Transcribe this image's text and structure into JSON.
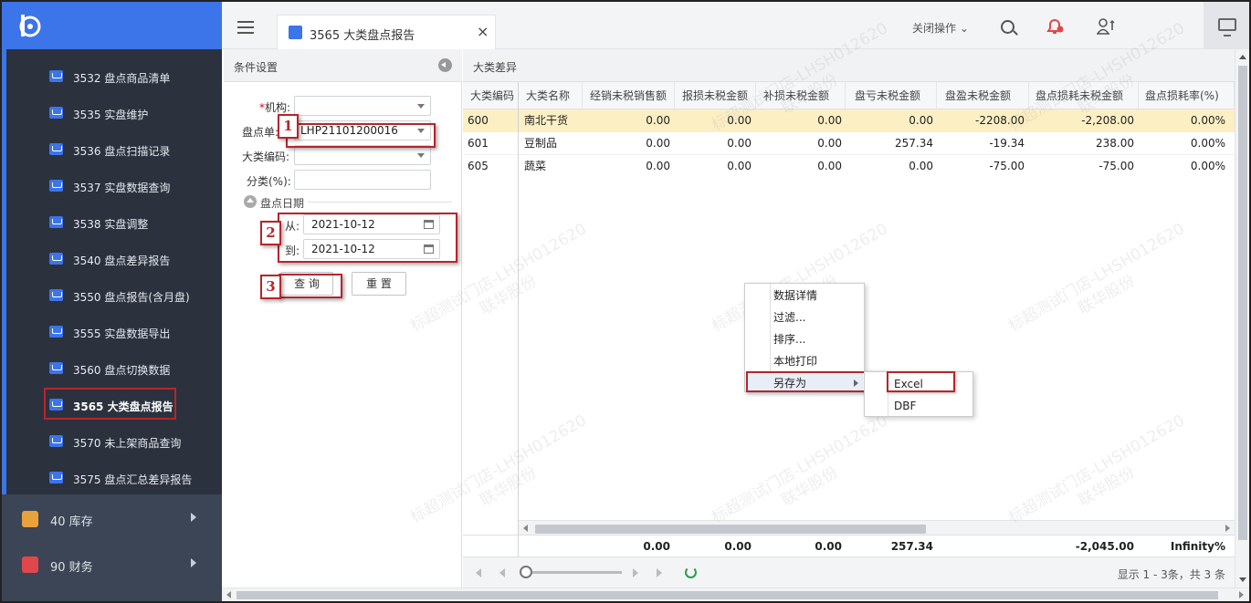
{
  "sidebar": {
    "items": [
      {
        "label": "3532 盘点商品清单"
      },
      {
        "label": "3535 实盘维护"
      },
      {
        "label": "3536 盘点扫描记录"
      },
      {
        "label": "3537 实盘数据查询"
      },
      {
        "label": "3538 实盘调整"
      },
      {
        "label": "3540 盘点差异报告"
      },
      {
        "label": "3550 盘点报告(含月盘)"
      },
      {
        "label": "3555 实盘数据导出"
      },
      {
        "label": "3560 盘点切换数据"
      },
      {
        "label": "3565 大类盘点报告"
      },
      {
        "label": "3570 未上架商品查询"
      },
      {
        "label": "3575 盘点汇总差异报告"
      }
    ],
    "groups": [
      {
        "label": "40 库存",
        "icon": "warehouse-icon",
        "color": "#e9a23b"
      },
      {
        "label": "90 财务",
        "icon": "finance-icon",
        "color": "#e0474c"
      }
    ]
  },
  "topbar": {
    "tab_title": "3565 大类盘点报告",
    "tab_close": "×",
    "close_ops": "关闭操作 ⌄"
  },
  "filter": {
    "title": "条件设置",
    "org_label": "机构:",
    "org_required": "*",
    "org_value": "",
    "sheet_label": "盘点单:",
    "sheet_value": "LHP21101200016",
    "category_label": "大类编码:",
    "category_value": "",
    "class_label": "分类(%):",
    "class_value": "",
    "date_section": "盘点日期",
    "from_label": "从:",
    "from_value": "2021-10-12",
    "to_label": "到:",
    "to_value": "2021-10-12",
    "query_btn": "查 询",
    "reset_btn": "重 置"
  },
  "callouts": [
    "1",
    "2",
    "3"
  ],
  "report": {
    "title": "大类差异",
    "columns": [
      "大类编码",
      "大类名称",
      "经销未税销售额",
      "报损未税金额",
      "补损未税金额",
      "盘亏未税金额",
      "盘盈未税金额",
      "盘点损耗未税金额",
      "盘点损耗率(%)"
    ],
    "rows": [
      [
        "600",
        "南北干货",
        "0.00",
        "0.00",
        "0.00",
        "0.00",
        "-2208.00",
        "-2,208.00",
        "0.00%"
      ],
      [
        "601",
        "豆制品",
        "0.00",
        "0.00",
        "0.00",
        "257.34",
        "-19.34",
        "238.00",
        "0.00%"
      ],
      [
        "605",
        "蔬菜",
        "0.00",
        "0.00",
        "0.00",
        "0.00",
        "-75.00",
        "-75.00",
        "0.00%"
      ]
    ],
    "totals": [
      "0.00",
      "0.00",
      "0.00",
      "257.34",
      "",
      "-2,045.00",
      "Infinity%"
    ],
    "pager_info": "显示 1 - 3条，共 3 条"
  },
  "context_menu": {
    "items": [
      "数据详情",
      "过滤...",
      "排序...",
      "本地打印",
      "另存为"
    ],
    "submenu": [
      "Excel",
      "DBF"
    ]
  },
  "watermark": {
    "line1": "标超测试门店-LHSH012620",
    "line2": "联华股份"
  },
  "colors": {
    "accent": "#3c74ea",
    "sidebar_bg": "#3b4555",
    "callout_red": "#b5262b",
    "selected_row": "#fdefc4"
  }
}
